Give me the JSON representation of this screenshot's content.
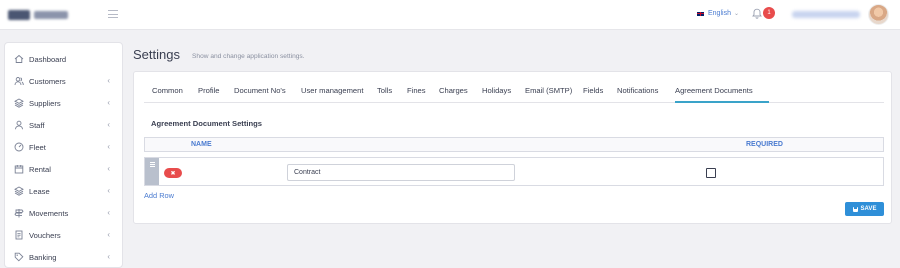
{
  "header": {
    "language": "English"
  },
  "notifications": {
    "count": "1"
  },
  "sidebar": {
    "items": [
      {
        "label": "Dashboard",
        "icon": "home-icon",
        "has_chevron": false
      },
      {
        "label": "Customers",
        "icon": "users-icon",
        "has_chevron": true
      },
      {
        "label": "Suppliers",
        "icon": "layers-icon",
        "has_chevron": true
      },
      {
        "label": "Staff",
        "icon": "user-icon",
        "has_chevron": true
      },
      {
        "label": "Fleet",
        "icon": "gauge-icon",
        "has_chevron": true
      },
      {
        "label": "Rental",
        "icon": "calendar-icon",
        "has_chevron": true
      },
      {
        "label": "Lease",
        "icon": "layers-icon",
        "has_chevron": true
      },
      {
        "label": "Movements",
        "icon": "signpost-icon",
        "has_chevron": true
      },
      {
        "label": "Vouchers",
        "icon": "document-icon",
        "has_chevron": true
      },
      {
        "label": "Banking",
        "icon": "tag-icon",
        "has_chevron": true
      }
    ]
  },
  "page": {
    "title": "Settings",
    "subtitle": "Show and change application settings."
  },
  "tabs": [
    "Common",
    "Profile",
    "Document No's",
    "User management",
    "Tolls",
    "Fines",
    "Charges",
    "Holidays",
    "Email (SMTP)",
    "Fields",
    "Notifications",
    "Agreement Documents"
  ],
  "active_tab": "Agreement Documents",
  "section": {
    "title": "Agreement Document Settings",
    "columns": {
      "name": "NAME",
      "required": "REQUIRED"
    },
    "rows": [
      {
        "name": "Contract",
        "required": false
      }
    ],
    "add_row_label": "Add Row",
    "save_label": "SAVE"
  },
  "colors": {
    "accent": "#2f8fd8",
    "link": "#4a7bd0",
    "danger": "#e84c4c",
    "tab_underline": "#3aa3c9"
  }
}
